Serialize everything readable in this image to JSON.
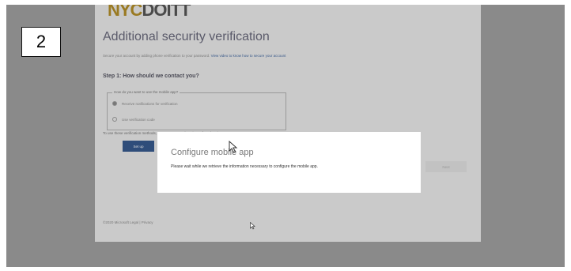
{
  "app": {
    "logo_nyc": "NYC",
    "logo_rest": "DOITT"
  },
  "page": {
    "heading": "Additional security verification",
    "intro_text": "Secure your account by adding phone verification to your password.",
    "intro_link": "View video to know how to secure your account",
    "step_title": "Step 1: How should we contact you?",
    "fieldset_legend": "How do you want to use the mobile app?",
    "radio_options": [
      {
        "label": "Receive notifications for verification",
        "selected": true
      },
      {
        "label": "Use verification code",
        "selected": false
      }
    ],
    "use_text": "To use these verification methods, you must set up the Microsoft Authenticator app.",
    "setup_button": "Set up",
    "next_button": "Next",
    "footer": "©2020 Microsoft   Legal  |  Privacy"
  },
  "dialog": {
    "title": "Configure mobile app",
    "message": "Please wait while we retrieve the information necessary to configure the mobile app."
  },
  "annotation": {
    "step_number": "2"
  },
  "colors": {
    "overlay": "#8a8a8a",
    "page_bg": "#cacaca",
    "button_blue": "#2f4d7a",
    "logo_gold": "#9a7a22"
  },
  "icons": [
    "mouse-pointer-icon",
    "arrow-cursor-icon"
  ]
}
